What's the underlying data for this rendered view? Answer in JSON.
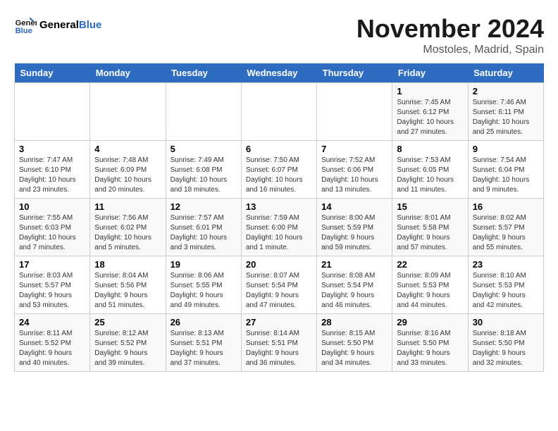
{
  "header": {
    "logo_general": "General",
    "logo_blue": "Blue",
    "month_title": "November 2024",
    "location": "Mostoles, Madrid, Spain"
  },
  "days_of_week": [
    "Sunday",
    "Monday",
    "Tuesday",
    "Wednesday",
    "Thursday",
    "Friday",
    "Saturday"
  ],
  "weeks": [
    {
      "days": [
        {
          "num": "",
          "info": ""
        },
        {
          "num": "",
          "info": ""
        },
        {
          "num": "",
          "info": ""
        },
        {
          "num": "",
          "info": ""
        },
        {
          "num": "",
          "info": ""
        },
        {
          "num": "1",
          "info": "Sunrise: 7:45 AM\nSunset: 6:12 PM\nDaylight: 10 hours\nand 27 minutes."
        },
        {
          "num": "2",
          "info": "Sunrise: 7:46 AM\nSunset: 6:11 PM\nDaylight: 10 hours\nand 25 minutes."
        }
      ]
    },
    {
      "days": [
        {
          "num": "3",
          "info": "Sunrise: 7:47 AM\nSunset: 6:10 PM\nDaylight: 10 hours\nand 23 minutes."
        },
        {
          "num": "4",
          "info": "Sunrise: 7:48 AM\nSunset: 6:09 PM\nDaylight: 10 hours\nand 20 minutes."
        },
        {
          "num": "5",
          "info": "Sunrise: 7:49 AM\nSunset: 6:08 PM\nDaylight: 10 hours\nand 18 minutes."
        },
        {
          "num": "6",
          "info": "Sunrise: 7:50 AM\nSunset: 6:07 PM\nDaylight: 10 hours\nand 16 minutes."
        },
        {
          "num": "7",
          "info": "Sunrise: 7:52 AM\nSunset: 6:06 PM\nDaylight: 10 hours\nand 13 minutes."
        },
        {
          "num": "8",
          "info": "Sunrise: 7:53 AM\nSunset: 6:05 PM\nDaylight: 10 hours\nand 11 minutes."
        },
        {
          "num": "9",
          "info": "Sunrise: 7:54 AM\nSunset: 6:04 PM\nDaylight: 10 hours\nand 9 minutes."
        }
      ]
    },
    {
      "days": [
        {
          "num": "10",
          "info": "Sunrise: 7:55 AM\nSunset: 6:03 PM\nDaylight: 10 hours\nand 7 minutes."
        },
        {
          "num": "11",
          "info": "Sunrise: 7:56 AM\nSunset: 6:02 PM\nDaylight: 10 hours\nand 5 minutes."
        },
        {
          "num": "12",
          "info": "Sunrise: 7:57 AM\nSunset: 6:01 PM\nDaylight: 10 hours\nand 3 minutes."
        },
        {
          "num": "13",
          "info": "Sunrise: 7:59 AM\nSunset: 6:00 PM\nDaylight: 10 hours\nand 1 minute."
        },
        {
          "num": "14",
          "info": "Sunrise: 8:00 AM\nSunset: 5:59 PM\nDaylight: 9 hours\nand 59 minutes."
        },
        {
          "num": "15",
          "info": "Sunrise: 8:01 AM\nSunset: 5:58 PM\nDaylight: 9 hours\nand 57 minutes."
        },
        {
          "num": "16",
          "info": "Sunrise: 8:02 AM\nSunset: 5:57 PM\nDaylight: 9 hours\nand 55 minutes."
        }
      ]
    },
    {
      "days": [
        {
          "num": "17",
          "info": "Sunrise: 8:03 AM\nSunset: 5:57 PM\nDaylight: 9 hours\nand 53 minutes."
        },
        {
          "num": "18",
          "info": "Sunrise: 8:04 AM\nSunset: 5:56 PM\nDaylight: 9 hours\nand 51 minutes."
        },
        {
          "num": "19",
          "info": "Sunrise: 8:06 AM\nSunset: 5:55 PM\nDaylight: 9 hours\nand 49 minutes."
        },
        {
          "num": "20",
          "info": "Sunrise: 8:07 AM\nSunset: 5:54 PM\nDaylight: 9 hours\nand 47 minutes."
        },
        {
          "num": "21",
          "info": "Sunrise: 8:08 AM\nSunset: 5:54 PM\nDaylight: 9 hours\nand 46 minutes."
        },
        {
          "num": "22",
          "info": "Sunrise: 8:09 AM\nSunset: 5:53 PM\nDaylight: 9 hours\nand 44 minutes."
        },
        {
          "num": "23",
          "info": "Sunrise: 8:10 AM\nSunset: 5:53 PM\nDaylight: 9 hours\nand 42 minutes."
        }
      ]
    },
    {
      "days": [
        {
          "num": "24",
          "info": "Sunrise: 8:11 AM\nSunset: 5:52 PM\nDaylight: 9 hours\nand 40 minutes."
        },
        {
          "num": "25",
          "info": "Sunrise: 8:12 AM\nSunset: 5:52 PM\nDaylight: 9 hours\nand 39 minutes."
        },
        {
          "num": "26",
          "info": "Sunrise: 8:13 AM\nSunset: 5:51 PM\nDaylight: 9 hours\nand 37 minutes."
        },
        {
          "num": "27",
          "info": "Sunrise: 8:14 AM\nSunset: 5:51 PM\nDaylight: 9 hours\nand 36 minutes."
        },
        {
          "num": "28",
          "info": "Sunrise: 8:15 AM\nSunset: 5:50 PM\nDaylight: 9 hours\nand 34 minutes."
        },
        {
          "num": "29",
          "info": "Sunrise: 8:16 AM\nSunset: 5:50 PM\nDaylight: 9 hours\nand 33 minutes."
        },
        {
          "num": "30",
          "info": "Sunrise: 8:18 AM\nSunset: 5:50 PM\nDaylight: 9 hours\nand 32 minutes."
        }
      ]
    }
  ]
}
